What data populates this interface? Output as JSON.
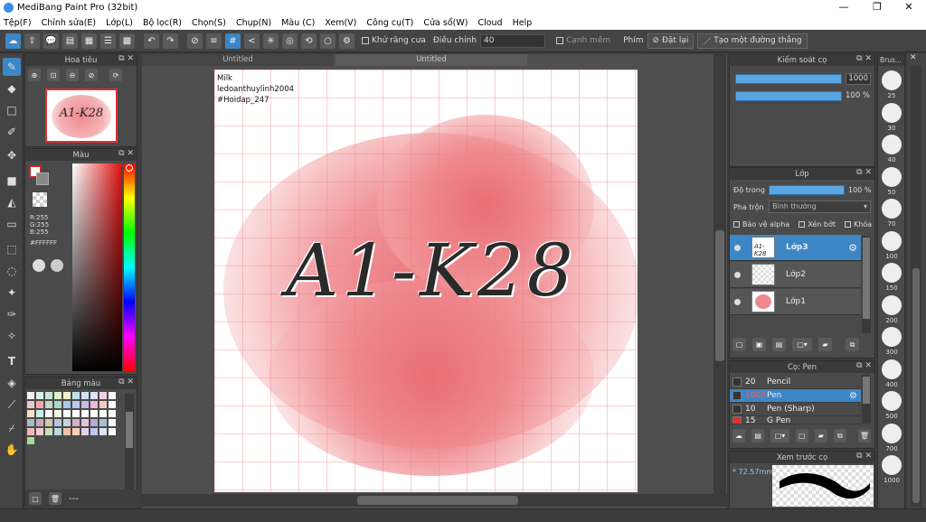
{
  "window": {
    "title": "MediBang Paint Pro (32bit)",
    "minimize_icon": "minimize-icon",
    "maximize_icon": "maximize-icon",
    "close_icon": "close-icon"
  },
  "menu": [
    "Tệp(F)",
    "Chỉnh sửa(E)",
    "Lớp(L)",
    "Bộ lọc(R)",
    "Chọn(S)",
    "Chụp(N)",
    "Màu (C)",
    "Xem(V)",
    "Công cụ(T)",
    "Cửa sổ(W)",
    "Cloud",
    "Help"
  ],
  "toolbar": {
    "antialias_label": "Khử răng cưa",
    "correction_label": "Điều chỉnh",
    "correction_value": "40",
    "edge_label": "Cạnh mềm",
    "key_label": "Phím",
    "reset_label": "Đặt lại",
    "straight_line_label": "Tạo một đường thẳng"
  },
  "panels": {
    "navigator": {
      "title": "Hoa tiêu",
      "preview_text": "A1-K28"
    },
    "color": {
      "title": "Màu",
      "r": "R:255",
      "g": "G:255",
      "b": "B:255",
      "hex": "#FFFFFF"
    },
    "palette": {
      "title": "Bảng màu",
      "footer": "---"
    },
    "brush_control": {
      "title": "Kiểm soát cọ",
      "size": "1000",
      "opacity": "100 %"
    },
    "layer": {
      "title": "Lớp",
      "opacity_label": "Độ trong",
      "opacity_value": "100 %",
      "blend_label": "Pha trộn",
      "blend_value": "Bình thường",
      "protect_alpha": "Bảo vệ alpha",
      "clipping": "Xén bớt",
      "lock": "Khóa",
      "layers": [
        {
          "name": "Lớp3",
          "selected": true
        },
        {
          "name": "Lớp2",
          "selected": false
        },
        {
          "name": "Lớp1",
          "selected": false
        }
      ]
    },
    "brushes": {
      "title": "Cọ: Pen",
      "items": [
        {
          "size": "20",
          "name": "Pencil"
        },
        {
          "size": "1000",
          "name": "Pen"
        },
        {
          "size": "10",
          "name": "Pen (Sharp)"
        },
        {
          "size": "15",
          "name": "G Pen"
        }
      ]
    },
    "brush_preview": {
      "title": "Xem trước cọ",
      "size": "* 72.57mm"
    },
    "brush_sizes": {
      "title": "Brus...",
      "sizes": [
        "25",
        "30",
        "40",
        "50",
        "70",
        "100",
        "150",
        "200",
        "300",
        "400",
        "500",
        "700",
        "1000"
      ]
    }
  },
  "tabs": [
    "Untitled",
    "Untitled"
  ],
  "canvas": {
    "watermark_lines": [
      "Milk",
      "ledoanthuylinh2004",
      "#Hoidap_247"
    ],
    "artwork_text": "A1-K28",
    "accent": "#3d86c6",
    "paint_color": "#e8686e"
  }
}
